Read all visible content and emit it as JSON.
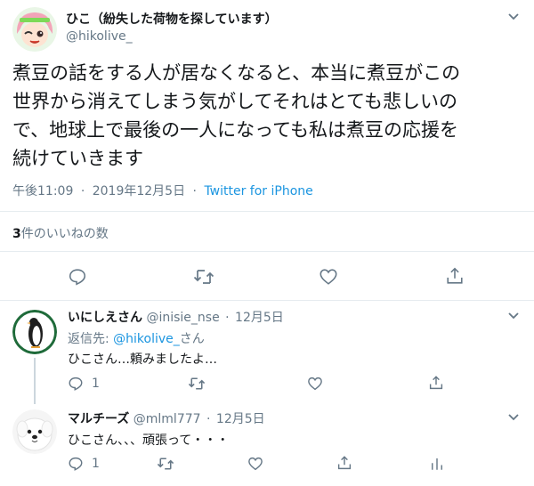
{
  "colors": {
    "accent": "#1b95e0",
    "text": "#14171a",
    "muted": "#657786",
    "divider": "#e6ecf0"
  },
  "tweet": {
    "display_name": "ひこ（紛失した荷物を探しています）",
    "handle": "@hikolive_",
    "text_lines": [
      "煮豆の話をする人が居なくなると、本当に煮豆がこの",
      "世界から消えてしまう気がしてそれはとても悲しいの",
      "で、地球上で最後の一人になっても私は煮豆の応援を",
      "続けていきます"
    ],
    "time": "午後11:09",
    "date": "2019年12月5日",
    "sep": "·",
    "source": "Twitter for iPhone",
    "likes_count": "3",
    "likes_label": "件のいいねの数",
    "icons": [
      "reply-icon",
      "retweet-icon",
      "like-icon",
      "share-icon",
      "chevron-down-icon"
    ]
  },
  "replies": [
    {
      "display_name": "いにしえさん",
      "handle": "@inisie_nse",
      "dot": "·",
      "date": "12月5日",
      "reply_to_prefix": "返信先: ",
      "reply_to_handle": "@hikolive_",
      "reply_to_suffix": "さん",
      "text": "ひこさん…頼みましたよ…",
      "reply_count": "1",
      "avatar_icon": "penguin-avatar"
    },
    {
      "display_name": "マルチーズ",
      "handle": "@mlml777",
      "dot": "·",
      "date": "12月5日",
      "text": "ひこさん、、、頑張って・・・",
      "reply_count": "1",
      "avatar_icon": "dog-avatar"
    }
  ]
}
